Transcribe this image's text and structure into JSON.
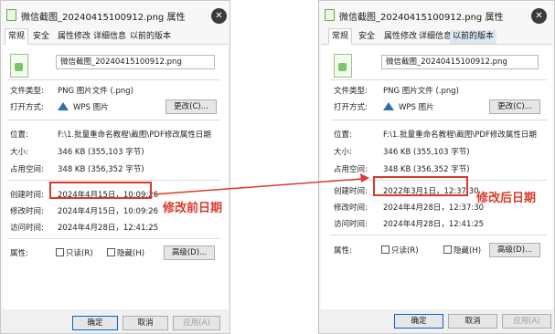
{
  "left": {
    "title": "微信截图_20240415100912.png 属性",
    "tabs": [
      "常规",
      "安全",
      "属性修改",
      "详细信息",
      "以前的版本"
    ],
    "file_name": "微信截图_20240415100912.png",
    "file_type_label": "文件类型:",
    "file_type_value": "PNG 图片文件 (.png)",
    "open_with_label": "打开方式:",
    "open_with_value": "WPS 图片",
    "change_button": "更改(C)...",
    "location_label": "位置:",
    "location_value": "F:\\1.批量重命名教程\\截图\\PDF修改属性日期",
    "size_label": "大小:",
    "size_value": "346 KB (355,103 字节)",
    "size_on_disk_label": "占用空间:",
    "size_on_disk_value": "348 KB (356,352 字节)",
    "created_label": "创建时间:",
    "created_value": "2024年4月15日，10:09:26",
    "modified_label": "修改时间:",
    "modified_value": "2024年4月15日，10:09:26",
    "accessed_label": "访问时间:",
    "accessed_value": "2024年4月28日，12:41:25",
    "attributes_label": "属性:",
    "readonly_label": "只读(R)",
    "hidden_label": "隐藏(H)",
    "advanced_button": "高级(D)...",
    "ok_button": "确定",
    "cancel_button": "取消",
    "apply_button": "应用(A)"
  },
  "right": {
    "title": "微信截图_20240415100912.png 属性",
    "tabs": [
      "常规",
      "安全",
      "属性修改",
      "详细信息",
      "以前的版本"
    ],
    "file_name": "微信截图_20240415100912.png",
    "file_type_label": "文件类型:",
    "file_type_value": "PNG 图片文件 (.png)",
    "open_with_label": "打开方式:",
    "open_with_value": "WPS 图片",
    "change_button": "更改(C)...",
    "location_label": "位置:",
    "location_value": "F:\\1.批量重命名教程\\截图\\PDF修改属性日期",
    "size_label": "大小:",
    "size_value": "346 KB (355,103 字节)",
    "size_on_disk_label": "占用空间:",
    "size_on_disk_value": "348 KB (356,352 字节)",
    "created_label": "创建时间:",
    "created_value": "2022年3月1日，12:37:30",
    "modified_label": "修改时间:",
    "modified_value": "2024年4月28日，12:37:30",
    "accessed_label": "访问时间:",
    "accessed_value": "2024年4月28日，12:41:25",
    "attributes_label": "属性:",
    "readonly_label": "只读(R)",
    "hidden_label": "隐藏(H)",
    "advanced_button": "高级(D)...",
    "ok_button": "确定",
    "cancel_button": "取消",
    "apply_button": "应用(A)"
  },
  "annotations": {
    "before_label": "修改前日期",
    "after_label": "修改后日期",
    "color": "#d93a2b"
  },
  "icons": {
    "close": "close-icon",
    "file": "png-file-icon",
    "wps": "wps-icon",
    "arrow": "arrow-icon"
  }
}
